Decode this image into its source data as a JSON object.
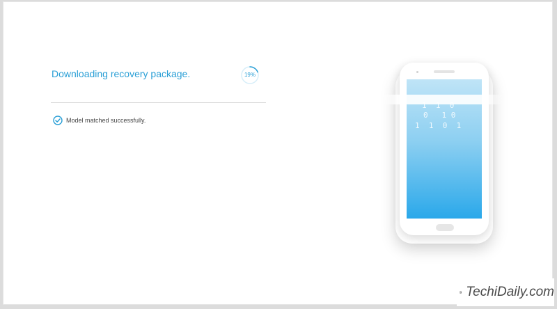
{
  "status": {
    "title": "Downloading recovery package.",
    "progress_percent": 19,
    "progress_label": "19%"
  },
  "steps": [
    {
      "label": "Model matched successfully.",
      "state": "done"
    }
  ],
  "illustration": {
    "binary_rows": [
      "1  1  0",
      "0   1 0",
      "1  1  0  1"
    ]
  },
  "watermark": {
    "text": "TechiDaily.com"
  },
  "colors": {
    "accent": "#2a9fd6",
    "screen_top": "#bfe4f7",
    "screen_bottom": "#2aa8ea"
  }
}
